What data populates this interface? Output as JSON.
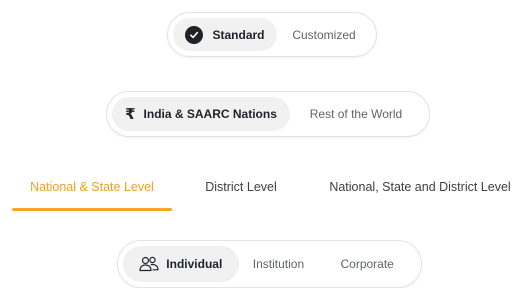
{
  "plan_toggle": {
    "options": [
      {
        "label": "Standard",
        "selected": true,
        "icon": "check-circle-icon"
      },
      {
        "label": "Customized",
        "selected": false
      }
    ]
  },
  "region_toggle": {
    "options": [
      {
        "label": "India & SAARC Nations",
        "selected": true,
        "icon": "rupee-icon",
        "icon_glyph": "₹"
      },
      {
        "label": "Rest of the World",
        "selected": false
      }
    ]
  },
  "level_tabs": {
    "items": [
      {
        "label": "National & State Level",
        "active": true
      },
      {
        "label": "District Level",
        "active": false
      },
      {
        "label": "National, State and District Level",
        "active": false
      }
    ],
    "active_color": "#f5a623"
  },
  "applicant_toggle": {
    "options": [
      {
        "label": "Individual",
        "selected": true,
        "icon": "people-icon"
      },
      {
        "label": "Institution",
        "selected": false
      },
      {
        "label": "Corporate",
        "selected": false
      }
    ]
  }
}
